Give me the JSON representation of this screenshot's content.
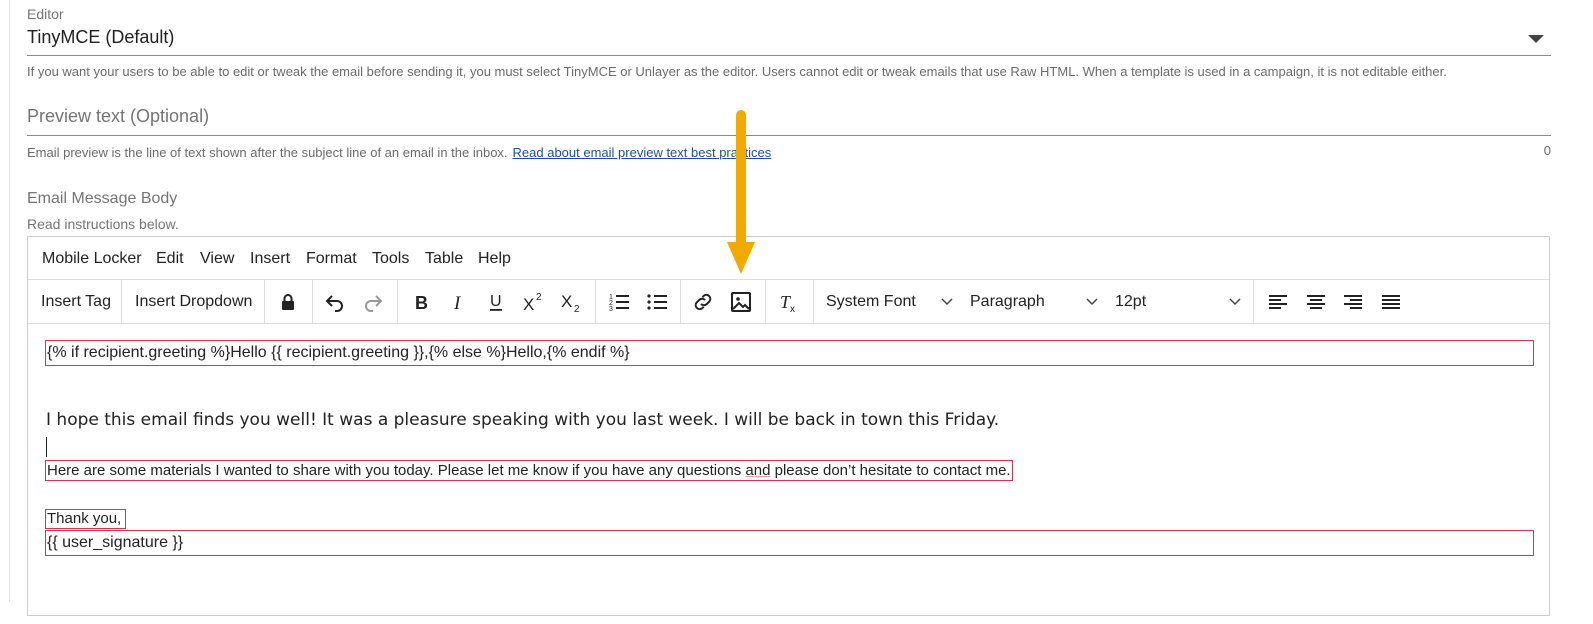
{
  "editor": {
    "label": "Editor",
    "value": "TinyMCE (Default)",
    "help": "If you want your users to be able to edit or tweak the email before sending it, you must select TinyMCE or Unlayer as the editor. Users cannot edit or tweak emails that use Raw HTML. When a template is used in a campaign, it is not editable either."
  },
  "preview": {
    "placeholder": "Preview text (Optional)",
    "help": "Email preview is the line of text shown after the subject line of an email in the inbox.",
    "link": "Read about email preview text best practices",
    "count": "0"
  },
  "body": {
    "label": "Email Message Body",
    "sub": "Read instructions below."
  },
  "menubar": [
    "Mobile Locker",
    "Edit",
    "View",
    "Insert",
    "Format",
    "Tools",
    "Table",
    "Help"
  ],
  "toolbar": {
    "insert_tag": "Insert Tag",
    "insert_dropdown": "Insert Dropdown",
    "font": "System Font",
    "block": "Paragraph",
    "size": "12pt",
    "icons": [
      "lock-icon",
      "undo-icon",
      "redo-icon",
      "bold-icon",
      "italic-icon",
      "underline-icon",
      "superscript-icon",
      "subscript-icon",
      "numbered-list-icon",
      "bullet-list-icon",
      "link-icon",
      "image-icon",
      "clear-formatting-icon",
      "align-left-icon",
      "align-center-icon",
      "align-right-icon",
      "justify-icon"
    ]
  },
  "content": {
    "greeting": "{% if recipient.greeting %}Hello {{ recipient.greeting }},{% else %}Hello,{% endif %}",
    "line1": "I hope this email finds you well! It was a pleasure speaking with you last week. I will be back in town this Friday.",
    "line2_a": "Here are some materials I wanted to share with you today. Please let me know if you have any questions ",
    "line2_b": "and",
    "line2_c": " please don’t hesitate to contact me.",
    "thanks": "Thank you,",
    "signature": "{{ user_signature }}"
  },
  "colors": {
    "accent_arrow": "#f2a900",
    "highlight_box": "#d0364f",
    "link": "#1a4f9c"
  }
}
